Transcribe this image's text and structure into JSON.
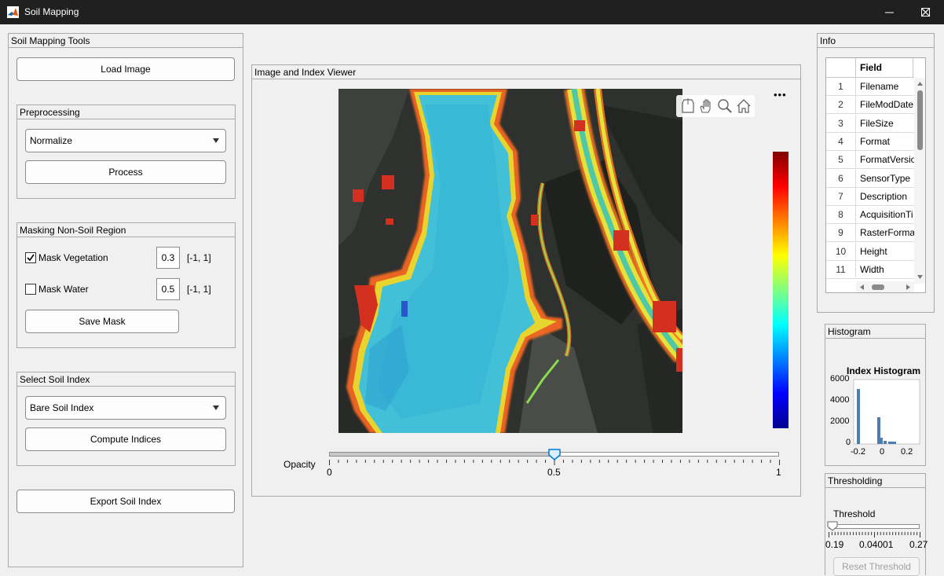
{
  "window": {
    "title": "Soil Mapping"
  },
  "tools_panel": {
    "title": "Soil Mapping Tools",
    "load_image_label": "Load Image",
    "preprocessing": {
      "title": "Preprocessing",
      "method_value": "Normalize",
      "process_label": "Process"
    },
    "masking": {
      "title": "Masking Non-Soil Region",
      "vegetation": {
        "label": "Mask Vegetation",
        "checked": true,
        "value": "0.3",
        "range": "[-1, 1]"
      },
      "water": {
        "label": "Mask Water",
        "checked": false,
        "value": "0.5",
        "range": "[-1, 1]"
      },
      "save_mask_label": "Save Mask"
    },
    "soil_index": {
      "title": "Select Soil Index",
      "index_value": "Bare Soil Index",
      "compute_label": "Compute Indices"
    },
    "export_label": "Export Soil Index"
  },
  "viewer": {
    "title": "Image and Index Viewer",
    "more_label": "•••",
    "toolbar_icons": [
      "export-icon",
      "pan-icon",
      "zoom-icon",
      "home-icon"
    ],
    "opacity": {
      "label": "Opacity",
      "value": 0.5,
      "min_label": "0",
      "mid_label": "0.5",
      "max_label": "1"
    },
    "colormap": "jet"
  },
  "info_panel": {
    "title": "Info",
    "column_header": "Field",
    "rows": [
      {
        "num": "1",
        "field": "Filename"
      },
      {
        "num": "2",
        "field": "FileModDate"
      },
      {
        "num": "3",
        "field": "FileSize"
      },
      {
        "num": "4",
        "field": "Format"
      },
      {
        "num": "5",
        "field": "FormatVersio"
      },
      {
        "num": "6",
        "field": "SensorType"
      },
      {
        "num": "7",
        "field": "Description"
      },
      {
        "num": "8",
        "field": "AcquisitionTi"
      },
      {
        "num": "9",
        "field": "RasterForma"
      },
      {
        "num": "10",
        "field": "Height"
      },
      {
        "num": "11",
        "field": "Width"
      }
    ]
  },
  "histogram_panel": {
    "title": "Histogram",
    "chart_title": "Index Histogram",
    "y_ticks": [
      "6000",
      "4000",
      "2000",
      "0"
    ],
    "x_ticks": [
      "-0.2",
      "0",
      "0.2"
    ]
  },
  "threshold_panel": {
    "title": "Thresholding",
    "label": "Threshold",
    "value_fraction": 0.04,
    "min_label": "0.19",
    "mid_label": "0.04001",
    "max_label": "0.27",
    "reset_label": "Reset Threshold"
  }
}
